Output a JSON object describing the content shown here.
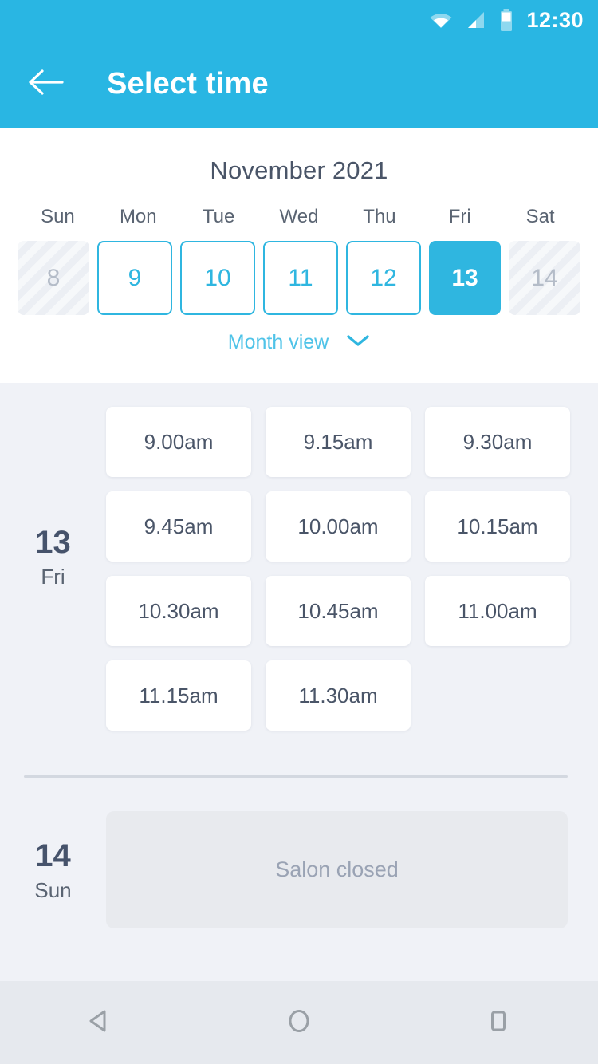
{
  "status_bar": {
    "time": "12:30",
    "icons": [
      "wifi-icon",
      "signal-icon",
      "battery-icon"
    ]
  },
  "app_bar": {
    "back_icon": "arrow-left-icon",
    "title": "Select time"
  },
  "calendar": {
    "month_title": "November 2021",
    "weekday_headers": [
      "Sun",
      "Mon",
      "Tue",
      "Wed",
      "Thu",
      "Fri",
      "Sat"
    ],
    "days": [
      {
        "number": "8",
        "state": "disabled"
      },
      {
        "number": "9",
        "state": "available"
      },
      {
        "number": "10",
        "state": "available"
      },
      {
        "number": "11",
        "state": "available"
      },
      {
        "number": "12",
        "state": "available"
      },
      {
        "number": "13",
        "state": "selected"
      },
      {
        "number": "14",
        "state": "disabled"
      }
    ],
    "month_view_label": "Month view",
    "month_view_icon": "chevron-down-icon"
  },
  "schedule": {
    "day_13": {
      "day_number": "13",
      "day_name": "Fri",
      "slots": [
        "9.00am",
        "9.15am",
        "9.30am",
        "9.45am",
        "10.00am",
        "10.15am",
        "10.30am",
        "10.45am",
        "11.00am",
        "11.15am",
        "11.30am"
      ]
    },
    "day_14": {
      "day_number": "14",
      "day_name": "Sun",
      "closed_message": "Salon closed"
    }
  },
  "nav_bar": {
    "back_icon": "triangle-back-icon",
    "home_icon": "circle-home-icon",
    "recents_icon": "square-recents-icon"
  },
  "colors": {
    "accent": "#29b6e3",
    "accent_light": "#2fb6e0",
    "link": "#4fc3e8",
    "page_bg": "#f0f2f7",
    "text_dark": "#46536b",
    "text_muted": "#9aa3b4"
  }
}
